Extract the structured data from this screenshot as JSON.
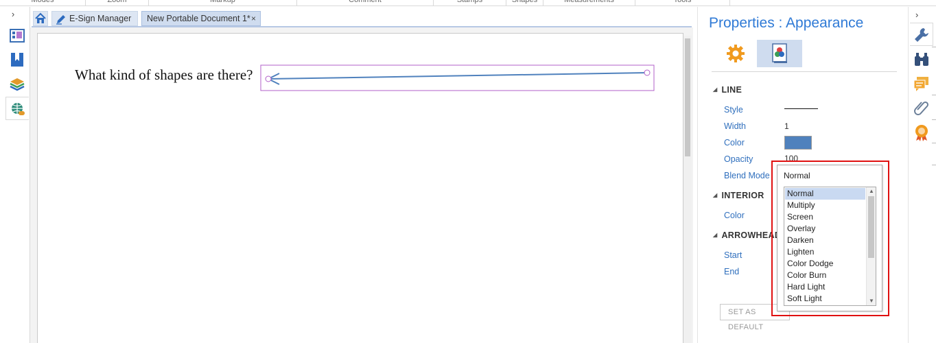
{
  "ribbon": {
    "groups": [
      "Modes",
      "Zoom",
      "Markup",
      "Comment",
      "Stamps",
      "Shapes",
      "Measurements",
      "Tools"
    ]
  },
  "left_bar": {
    "icons": [
      "expand-chevron-icon",
      "thumbnails-icon",
      "bookmarks-icon",
      "layers-icon",
      "links-icon"
    ]
  },
  "tabs": [
    {
      "label": "E-Sign Manager",
      "active": false
    },
    {
      "label": "New Portable Document 1*",
      "active": true,
      "close": "×"
    }
  ],
  "document": {
    "question_text": "What kind of shapes are there?",
    "shape": {
      "kind": "arrow-line",
      "stroke": "#4f81bd",
      "selection_color": "#b15fc8"
    }
  },
  "properties": {
    "title": "Properties : Appearance",
    "tabs": [
      {
        "name": "settings-gear-icon",
        "active": false
      },
      {
        "name": "appearance-icon",
        "active": true
      }
    ],
    "sections": {
      "line": {
        "header": "LINE",
        "style_label": "Style",
        "width_label": "Width",
        "width_value": "1",
        "color_label": "Color",
        "color_value": "#4f81bd",
        "opacity_label": "Opacity",
        "opacity_value": "100",
        "blend_mode_label": "Blend Mode"
      },
      "interior": {
        "header": "INTERIOR",
        "color_label": "Color"
      },
      "arrowheads": {
        "header": "ARROWHEAD",
        "start_label": "Start",
        "end_label": "End"
      }
    },
    "set_default_label": "SET AS DEFAULT"
  },
  "blend_dropdown": {
    "value": "Normal",
    "options": [
      "Normal",
      "Multiply",
      "Screen",
      "Overlay",
      "Darken",
      "Lighten",
      "Color Dodge",
      "Color Burn",
      "Hard Light",
      "Soft Light"
    ],
    "selected": "Normal"
  },
  "right_bar": {
    "icons": [
      "expand-chevron-icon",
      "wrench-icon",
      "binoculars-icon",
      "comments-icon",
      "attachment-icon",
      "certificate-icon"
    ]
  },
  "colors": {
    "accent": "#2f7ad6",
    "highlight": "#e01010",
    "tab_active": "#cfdcef"
  }
}
